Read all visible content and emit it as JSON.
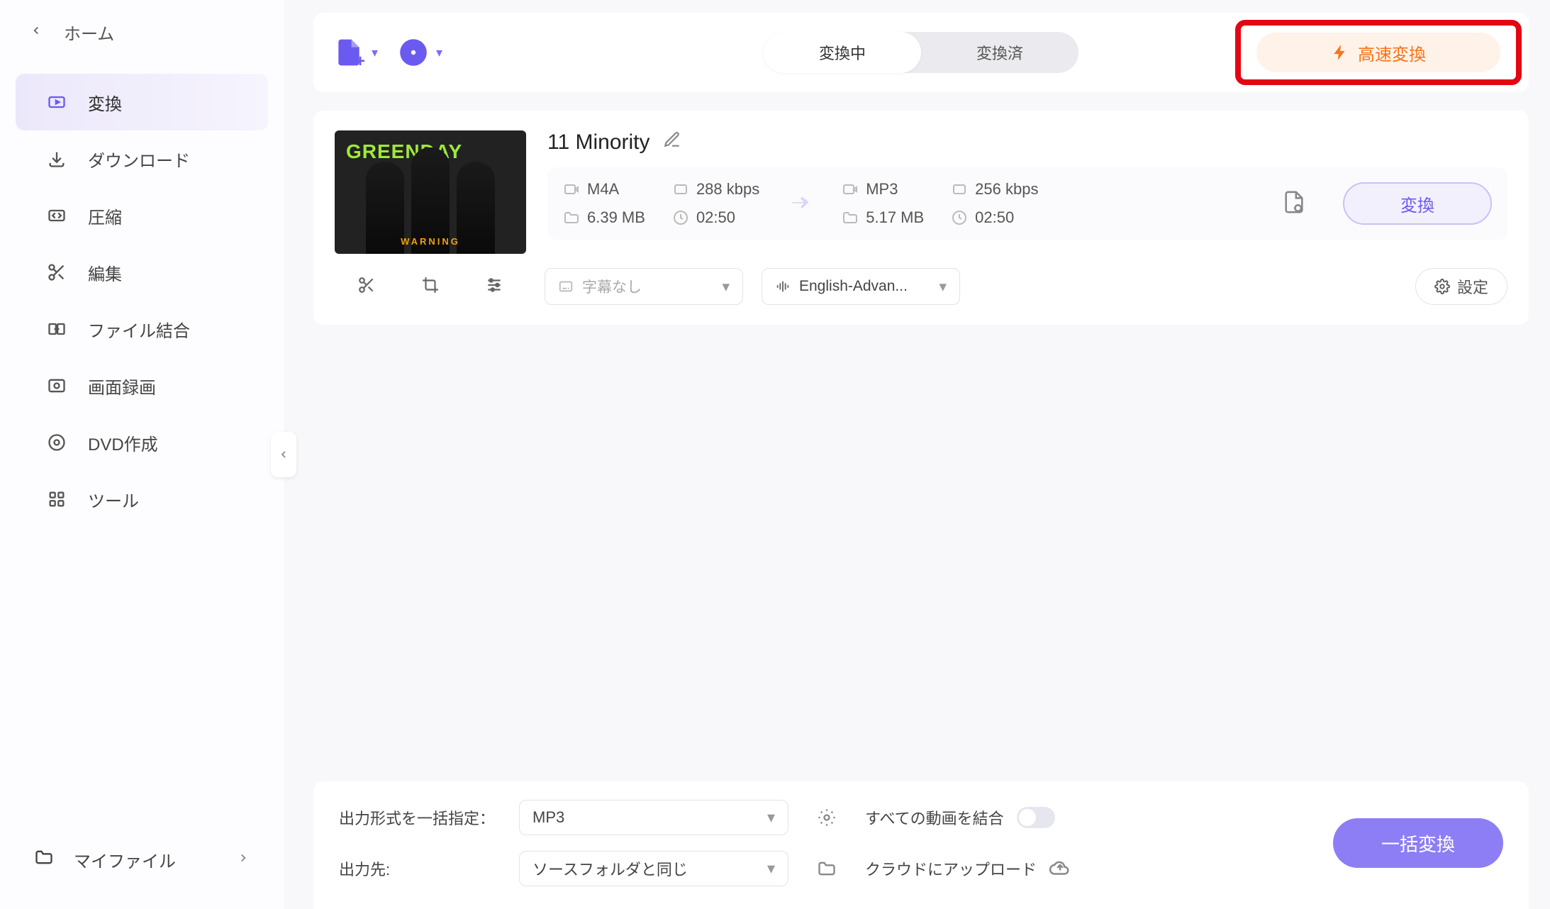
{
  "home": {
    "label": "ホーム"
  },
  "sidebar": {
    "items": [
      {
        "label": "変換"
      },
      {
        "label": "ダウンロード"
      },
      {
        "label": "圧縮"
      },
      {
        "label": "編集"
      },
      {
        "label": "ファイル結合"
      },
      {
        "label": "画面録画"
      },
      {
        "label": "DVD作成"
      },
      {
        "label": "ツール"
      }
    ],
    "myfiles": "マイファイル"
  },
  "topbar": {
    "tabs": {
      "converting": "変換中",
      "converted": "変換済"
    },
    "fast_convert": "高速変換"
  },
  "file": {
    "title": "11 Minority",
    "thumb_band": "GREENDAY",
    "thumb_sub": "WARNING",
    "src": {
      "format": "M4A",
      "bitrate": "288 kbps",
      "size": "6.39 MB",
      "duration": "02:50"
    },
    "dst": {
      "format": "MP3",
      "bitrate": "256 kbps",
      "size": "5.17 MB",
      "duration": "02:50"
    },
    "subtitle_placeholder": "字幕なし",
    "lang": "English-Advan...",
    "settings_label": "設定",
    "convert_label": "変換"
  },
  "footer": {
    "format_label": "出力形式を一括指定：",
    "format_value": "MP3",
    "dest_label": "出力先:",
    "dest_value": "ソースフォルダと同じ",
    "merge_label": "すべての動画を結合",
    "upload_label": "クラウドにアップロード",
    "batch_label": "一括変換"
  }
}
